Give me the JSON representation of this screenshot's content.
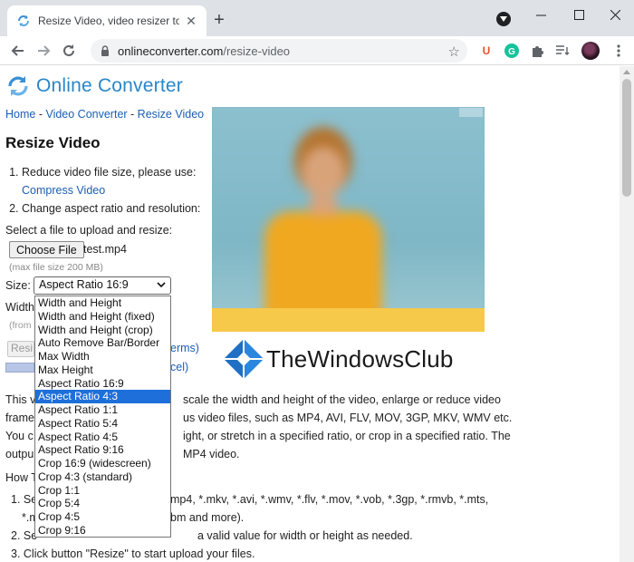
{
  "browser": {
    "tab_title": "Resize Video, video resizer to sca",
    "url_host": "onlineconverter.com",
    "url_path": "/resize-video"
  },
  "site": {
    "logo_text": "Online Converter",
    "breadcrumb": [
      "Home",
      "Video Converter",
      "Resize Video"
    ],
    "breadcrumb_sep": " - "
  },
  "main": {
    "title": "Resize Video",
    "steps": [
      {
        "text": "Reduce video file size, please use:",
        "link": "Compress Video"
      },
      {
        "text": "Change aspect ratio and resolution:",
        "link": ""
      }
    ],
    "upload_label": "Select a file to upload and resize:",
    "choose_button": "Choose File",
    "file_name": "test.mp4",
    "max_size_hint": "(max file size 200 MB)",
    "size_label": "Size:",
    "size_selected": "Aspect Ratio 16:9",
    "size_options": [
      "Width and Height",
      "Width and Height (fixed)",
      "Width and Height (crop)",
      "Auto Remove Bar/Border",
      "Max Width",
      "Max Height",
      "Aspect Ratio 16:9",
      "Aspect Ratio 4:3",
      "Aspect Ratio 1:1",
      "Aspect Ratio 5:4",
      "Aspect Ratio 4:5",
      "Aspect Ratio 9:16",
      "Crop 16:9 (widescreen)",
      "Crop 4:3 (standard)",
      "Crop 1:1",
      "Crop 5:4",
      "Crop 4:5",
      "Crop 9:16"
    ],
    "highlighted_option": "Aspect Ratio 4:3",
    "width_label_partial": "Width",
    "from_partial": "(from",
    "resize_button_partial": "Resi",
    "terms_partial": "erms)",
    "cancel_partial": "cel)"
  },
  "watermark": {
    "text": "TheWindowsClub"
  },
  "description_rows": [
    "This v",
    "frame",
    "You c",
    "outpu"
  ],
  "description_right": [
    "scale the width and height of the video, enlarge or reduce video",
    "us video files, such as MP4, AVI, FLV, MOV, 3GP, MKV, WMV etc.",
    "ight, or stretch in a specified ratio, or crop in a specified ratio. The",
    "MP4 video."
  ],
  "howto": {
    "heading": "How T",
    "rows_left": [
      "1. Se",
      "*.m",
      "2. Se"
    ],
    "rows_right": [
      "mp4, *.mkv, *.avi, *.wmv, *.flv, *.mov, *.vob, *.3gp, *.rmvb, *.mts,",
      "bm and more).",
      "a valid value for width or height as needed."
    ],
    "step3": "3. Click button \"Resize\" to start upload your files."
  },
  "colors": {
    "link": "#1a5fb4",
    "logo": "#2a86c8",
    "selected": "#1e6fd9"
  }
}
